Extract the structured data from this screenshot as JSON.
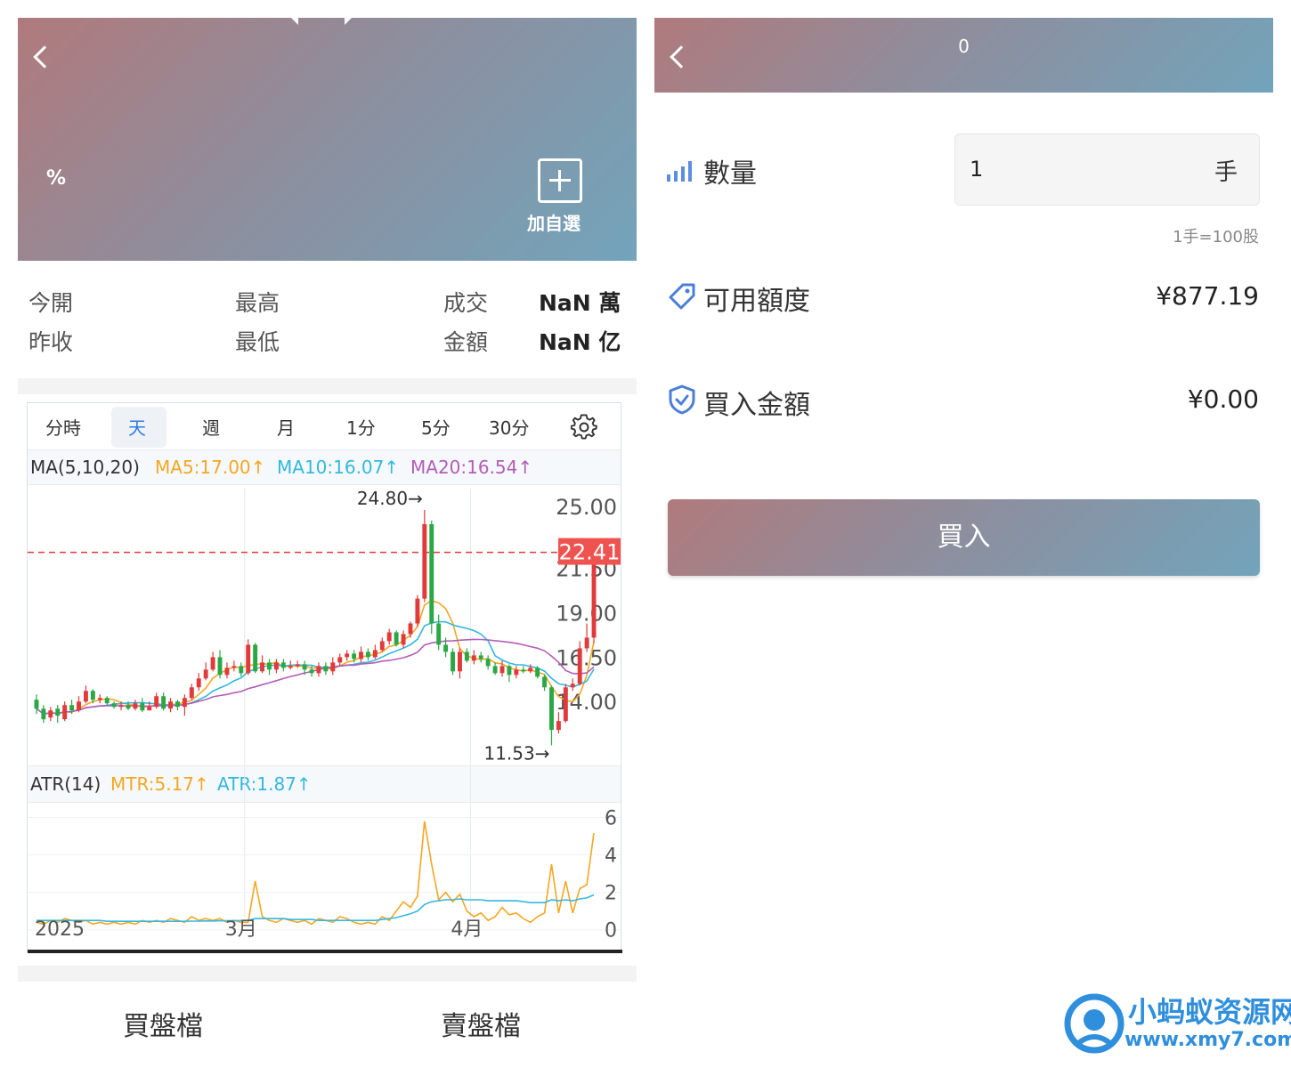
{
  "left": {
    "header": {
      "percent_label": "%",
      "add_favorite_label": "加自選"
    },
    "stats": {
      "open_label": "今開",
      "high_label": "最高",
      "volume_label": "成交",
      "volume_value": "NaN 萬",
      "prev_close_label": "昨收",
      "low_label": "最低",
      "amount_label": "金額",
      "amount_value": "NaN 亿"
    },
    "chart_tabs": [
      "分時",
      "天",
      "週",
      "月",
      "1分",
      "5分",
      "30分"
    ],
    "active_tab": "天",
    "ma_legend": {
      "prefix": "MA(5,10,20)",
      "ma5": "MA5:17.00↑",
      "ma10": "MA10:16.07↑",
      "ma20": "MA20:16.54↑"
    },
    "atr_legend": {
      "prefix": "ATR(14)",
      "mtr": "MTR:5.17↑",
      "atr": "ATR:1.87↑"
    },
    "order_book_tabs": {
      "buy": "買盤檔",
      "sell": "賣盤檔"
    }
  },
  "chart_data": [
    {
      "type": "candlestick",
      "title": "",
      "y_axis_ticks": [
        "25.00",
        "21.50",
        "19.00",
        "16.50",
        "14.00"
      ],
      "y_axis_values": [
        25.0,
        21.5,
        19.0,
        16.5,
        14.0
      ],
      "ylim": [
        10.5,
        26.0
      ],
      "x_axis_labels": [
        "2025",
        "3月",
        "4月"
      ],
      "current_price_label": "22.41",
      "current_price": 22.41,
      "max_annotation": "24.80→",
      "max_value": 24.8,
      "min_annotation": "11.53→",
      "min_value": 11.53,
      "candles": [
        [
          14.1,
          13.6,
          14.4,
          13.3
        ],
        [
          13.6,
          13.0,
          13.8,
          12.8
        ],
        [
          13.1,
          13.5,
          13.7,
          12.9
        ],
        [
          13.6,
          13.2,
          13.8,
          12.8
        ],
        [
          13.0,
          13.8,
          14.0,
          12.9
        ],
        [
          13.8,
          13.5,
          14.1,
          13.3
        ],
        [
          13.5,
          14.0,
          14.3,
          13.4
        ],
        [
          14.0,
          14.6,
          14.9,
          13.9
        ],
        [
          14.6,
          14.1,
          14.7,
          13.9
        ],
        [
          14.1,
          14.2,
          14.4,
          13.9
        ],
        [
          14.2,
          13.9,
          14.3,
          13.8
        ],
        [
          13.9,
          13.7,
          14.0,
          13.6
        ],
        [
          13.7,
          13.8,
          14.0,
          13.5
        ],
        [
          13.8,
          13.6,
          14.0,
          13.5
        ],
        [
          13.6,
          13.9,
          14.1,
          13.5
        ],
        [
          13.9,
          13.5,
          14.2,
          13.4
        ],
        [
          13.5,
          13.7,
          14.0,
          13.5
        ],
        [
          13.7,
          14.3,
          14.5,
          13.6
        ],
        [
          14.3,
          13.6,
          14.5,
          13.5
        ],
        [
          13.6,
          14.0,
          14.2,
          13.4
        ],
        [
          14.0,
          13.7,
          14.1,
          13.5
        ],
        [
          13.7,
          14.2,
          14.4,
          13.2
        ],
        [
          14.2,
          14.8,
          15.0,
          14.1
        ],
        [
          14.8,
          15.3,
          15.6,
          14.6
        ],
        [
          15.3,
          15.8,
          16.2,
          15.2
        ],
        [
          15.8,
          16.5,
          16.8,
          15.7
        ],
        [
          16.5,
          15.5,
          16.9,
          15.3
        ],
        [
          15.5,
          15.9,
          16.2,
          15.3
        ],
        [
          15.9,
          16.0,
          16.3,
          15.7
        ],
        [
          16.0,
          15.6,
          16.2,
          15.4
        ],
        [
          15.6,
          17.2,
          17.5,
          15.5
        ],
        [
          17.2,
          15.7,
          17.3,
          15.6
        ],
        [
          15.7,
          16.2,
          16.6,
          15.6
        ],
        [
          16.2,
          15.8,
          16.4,
          15.5
        ],
        [
          15.8,
          16.2,
          16.4,
          15.6
        ],
        [
          16.2,
          15.9,
          16.4,
          15.7
        ],
        [
          15.9,
          16.0,
          16.3,
          15.8
        ],
        [
          16.0,
          16.1,
          16.3,
          15.9
        ],
        [
          16.1,
          15.8,
          16.3,
          15.5
        ],
        [
          15.8,
          15.6,
          16.0,
          15.4
        ],
        [
          15.6,
          16.0,
          16.2,
          15.4
        ],
        [
          16.0,
          15.7,
          16.2,
          15.5
        ],
        [
          15.7,
          16.2,
          16.5,
          15.5
        ],
        [
          16.2,
          16.5,
          16.7,
          16.0
        ],
        [
          16.5,
          16.7,
          16.9,
          16.3
        ],
        [
          16.7,
          16.4,
          16.9,
          16.2
        ],
        [
          16.4,
          16.8,
          17.1,
          16.2
        ],
        [
          16.8,
          16.5,
          17.0,
          16.3
        ],
        [
          16.5,
          16.9,
          17.2,
          16.4
        ],
        [
          16.9,
          17.4,
          17.6,
          16.8
        ],
        [
          17.4,
          17.9,
          18.1,
          17.2
        ],
        [
          17.9,
          17.2,
          18.0,
          17.1
        ],
        [
          17.2,
          17.8,
          18.0,
          17.0
        ],
        [
          17.8,
          18.4,
          18.5,
          17.6
        ],
        [
          18.4,
          19.8,
          20.0,
          18.2
        ],
        [
          19.8,
          24.0,
          24.8,
          19.6
        ],
        [
          24.0,
          18.4,
          24.2,
          17.8
        ],
        [
          18.4,
          17.2,
          18.9,
          16.9
        ],
        [
          17.2,
          16.8,
          17.6,
          16.5
        ],
        [
          16.8,
          15.7,
          17.0,
          15.5
        ],
        [
          15.7,
          16.8,
          17.0,
          15.3
        ],
        [
          16.8,
          16.3,
          17.0,
          16.2
        ],
        [
          16.3,
          16.6,
          16.9,
          16.1
        ],
        [
          16.6,
          16.4,
          16.8,
          16.2
        ],
        [
          16.4,
          16.0,
          16.6,
          15.8
        ],
        [
          16.0,
          15.6,
          16.2,
          15.5
        ],
        [
          15.6,
          16.0,
          16.3,
          15.4
        ],
        [
          16.0,
          15.5,
          16.1,
          15.1
        ],
        [
          15.5,
          15.8,
          16.0,
          15.3
        ],
        [
          15.8,
          15.7,
          16.0,
          15.6
        ],
        [
          15.7,
          15.9,
          16.1,
          15.6
        ],
        [
          15.9,
          15.4,
          16.0,
          15.3
        ],
        [
          15.4,
          14.8,
          15.5,
          14.6
        ],
        [
          14.8,
          12.4,
          14.9,
          11.53
        ],
        [
          12.4,
          12.9,
          13.4,
          12.2
        ],
        [
          12.9,
          14.8,
          15.0,
          12.8
        ],
        [
          14.8,
          15.0,
          15.3,
          14.6
        ],
        [
          15.0,
          17.0,
          17.4,
          14.9
        ],
        [
          17.0,
          17.6,
          18.4,
          16.8
        ],
        [
          17.6,
          22.41,
          22.6,
          17.3
        ]
      ],
      "ma5_last": 17.0,
      "ma10_last": 16.07,
      "ma20_last": 16.54
    },
    {
      "type": "line",
      "title": "ATR(14)",
      "y_axis_ticks": [
        "6",
        "4",
        "2",
        "0"
      ],
      "y_axis_values": [
        6,
        4,
        2,
        0
      ],
      "ylim": [
        -0.3,
        6.5
      ],
      "series": [
        {
          "name": "MTR",
          "values": [
            0.4,
            0.3,
            0.5,
            0.4,
            0.6,
            0.5,
            0.4,
            0.5,
            0.3,
            0.4,
            0.3,
            0.4,
            0.3,
            0.4,
            0.3,
            0.5,
            0.4,
            0.5,
            0.4,
            0.6,
            0.5,
            0.4,
            0.7,
            0.5,
            0.6,
            0.5,
            0.6,
            0.4,
            0.5,
            0.4,
            0.4,
            2.6,
            0.7,
            0.5,
            0.4,
            0.6,
            0.5,
            0.4,
            0.5,
            0.3,
            0.6,
            0.5,
            0.4,
            0.7,
            0.6,
            0.4,
            0.3,
            0.4,
            0.3,
            0.7,
            0.5,
            1.0,
            1.5,
            1.2,
            1.8,
            5.8,
            3.5,
            1.6,
            2.0,
            1.5,
            1.9,
            1.0,
            0.7,
            0.9,
            0.5,
            0.7,
            1.2,
            0.8,
            0.9,
            0.6,
            0.4,
            0.7,
            0.9,
            3.5,
            0.9,
            2.6,
            0.9,
            2.2,
            2.4,
            5.17
          ]
        },
        {
          "name": "ATR",
          "values": [
            0.5,
            0.5,
            0.5,
            0.5,
            0.5,
            0.5,
            0.5,
            0.5,
            0.5,
            0.5,
            0.45,
            0.45,
            0.45,
            0.45,
            0.45,
            0.45,
            0.45,
            0.45,
            0.45,
            0.45,
            0.45,
            0.45,
            0.46,
            0.46,
            0.47,
            0.47,
            0.48,
            0.48,
            0.49,
            0.49,
            0.5,
            0.6,
            0.6,
            0.6,
            0.6,
            0.6,
            0.55,
            0.55,
            0.55,
            0.55,
            0.5,
            0.5,
            0.5,
            0.5,
            0.5,
            0.5,
            0.5,
            0.5,
            0.5,
            0.55,
            0.6,
            0.65,
            0.75,
            0.85,
            1.0,
            1.35,
            1.5,
            1.55,
            1.6,
            1.6,
            1.65,
            1.6,
            1.6,
            1.6,
            1.55,
            1.55,
            1.55,
            1.55,
            1.55,
            1.5,
            1.45,
            1.45,
            1.45,
            1.6,
            1.55,
            1.6,
            1.55,
            1.65,
            1.7,
            1.87
          ]
        }
      ]
    }
  ],
  "right": {
    "header": {
      "title": "0"
    },
    "quantity_label": "數量",
    "quantity_value": "1",
    "quantity_unit": "手",
    "lot_note": "1手=100股",
    "available_label": "可用額度",
    "available_value": "¥877.19",
    "buy_amount_label": "買入金額",
    "buy_amount_value": "¥0.00",
    "buy_button_label": "買入"
  },
  "watermark": {
    "name": "小蚂蚁资源网",
    "url": "www.xmy7.com"
  },
  "colors": {
    "up": "#e03a3a",
    "down": "#2aa846",
    "ma5": "#f5a623",
    "ma10": "#33b8e0",
    "ma20": "#b45cb8",
    "price_line": "#e03a3a"
  }
}
